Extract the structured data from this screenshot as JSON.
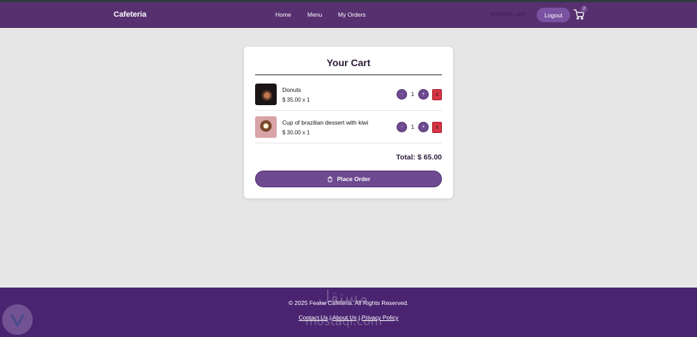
{
  "navbar": {
    "brand": "Cafeteria",
    "links": [
      "Home",
      "Menu",
      "My Orders"
    ],
    "welcome": "Welcome, user",
    "logout_label": "Logout",
    "cart_count": "2"
  },
  "cart": {
    "title": "Your Cart",
    "items": [
      {
        "name": "Donuts",
        "price_line": "$ 35.00 x 1",
        "qty": "1",
        "minus": "-",
        "plus": "+",
        "remove": "X"
      },
      {
        "name": "Cup of brazilian dessert with kiwi",
        "price_line": "$ 30.00 x 1",
        "qty": "1",
        "minus": "-",
        "plus": "+",
        "remove": "X"
      }
    ],
    "total": "Total: $ 65.00",
    "place_order_label": "Place Order"
  },
  "footer": {
    "copyright": "© 2025 Feane Cafeteria. All Rights Reserved.",
    "links": [
      "Contact Us",
      "About Us",
      "Privacy Policy"
    ],
    "separator": " | "
  },
  "watermark": {
    "arabic": "مستقل",
    "latin": "mostaqi.com"
  },
  "colors": {
    "navbar": "#56306f",
    "accent": "#6e4a91",
    "remove": "#d83545",
    "footer": "#4a2470",
    "background": "#e6e6e6"
  }
}
